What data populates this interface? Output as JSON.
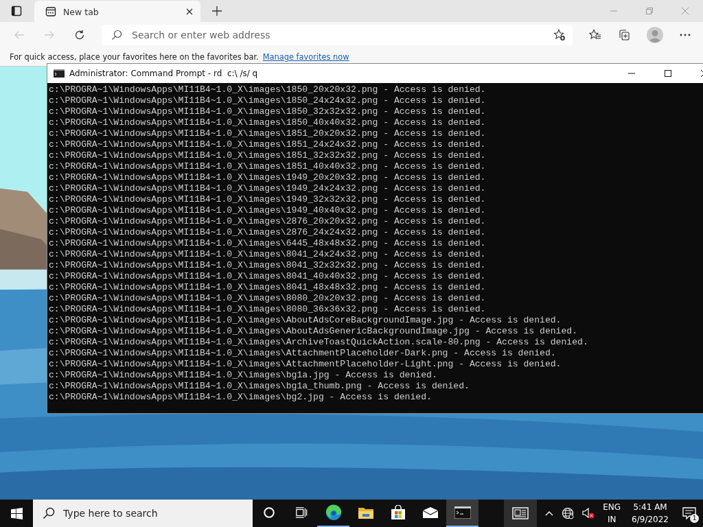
{
  "browser": {
    "tab": {
      "title": "New tab",
      "selected": true
    },
    "address": {
      "placeholder": "Search or enter web address"
    },
    "favorites_bar": {
      "message": "For quick access, place your favorites here on the favorites bar.",
      "link": "Manage favorites now"
    }
  },
  "console": {
    "title": "Administrator: Command Prompt - rd  c:\\ /s/ q",
    "lines": [
      "c:\\PROGRA~1\\WindowsApps\\MI11B4~1.0_X\\images\\1850_20x20x32.png - Access is denied.",
      "c:\\PROGRA~1\\WindowsApps\\MI11B4~1.0_X\\images\\1850_24x24x32.png - Access is denied.",
      "c:\\PROGRA~1\\WindowsApps\\MI11B4~1.0_X\\images\\1850_32x32x32.png - Access is denied.",
      "c:\\PROGRA~1\\WindowsApps\\MI11B4~1.0_X\\images\\1850_40x40x32.png - Access is denied.",
      "c:\\PROGRA~1\\WindowsApps\\MI11B4~1.0_X\\images\\1851_20x20x32.png - Access is denied.",
      "c:\\PROGRA~1\\WindowsApps\\MI11B4~1.0_X\\images\\1851_24x24x32.png - Access is denied.",
      "c:\\PROGRA~1\\WindowsApps\\MI11B4~1.0_X\\images\\1851_32x32x32.png - Access is denied.",
      "c:\\PROGRA~1\\WindowsApps\\MI11B4~1.0_X\\images\\1851_40x40x32.png - Access is denied.",
      "c:\\PROGRA~1\\WindowsApps\\MI11B4~1.0_X\\images\\1949_20x20x32.png - Access is denied.",
      "c:\\PROGRA~1\\WindowsApps\\MI11B4~1.0_X\\images\\1949_24x24x32.png - Access is denied.",
      "c:\\PROGRA~1\\WindowsApps\\MI11B4~1.0_X\\images\\1949_32x32x32.png - Access is denied.",
      "c:\\PROGRA~1\\WindowsApps\\MI11B4~1.0_X\\images\\1949_40x40x32.png - Access is denied.",
      "c:\\PROGRA~1\\WindowsApps\\MI11B4~1.0_X\\images\\2876_20x20x32.png - Access is denied.",
      "c:\\PROGRA~1\\WindowsApps\\MI11B4~1.0_X\\images\\2876_24x24x32.png - Access is denied.",
      "c:\\PROGRA~1\\WindowsApps\\MI11B4~1.0_X\\images\\6445_48x48x32.png - Access is denied.",
      "c:\\PROGRA~1\\WindowsApps\\MI11B4~1.0_X\\images\\8041_24x24x32.png - Access is denied.",
      "c:\\PROGRA~1\\WindowsApps\\MI11B4~1.0_X\\images\\8041_32x32x32.png - Access is denied.",
      "c:\\PROGRA~1\\WindowsApps\\MI11B4~1.0_X\\images\\8041_40x40x32.png - Access is denied.",
      "c:\\PROGRA~1\\WindowsApps\\MI11B4~1.0_X\\images\\8041_48x48x32.png - Access is denied.",
      "c:\\PROGRA~1\\WindowsApps\\MI11B4~1.0_X\\images\\8080_20x20x32.png - Access is denied.",
      "c:\\PROGRA~1\\WindowsApps\\MI11B4~1.0_X\\images\\8080_36x36x32.png - Access is denied.",
      "c:\\PROGRA~1\\WindowsApps\\MI11B4~1.0_X\\images\\AboutAdsCoreBackgroundImage.jpg - Access is denied.",
      "c:\\PROGRA~1\\WindowsApps\\MI11B4~1.0_X\\images\\AboutAdsGenericBackgroundImage.jpg - Access is denied.",
      "c:\\PROGRA~1\\WindowsApps\\MI11B4~1.0_X\\images\\ArchiveToastQuickAction.scale-80.png - Access is denied.",
      "c:\\PROGRA~1\\WindowsApps\\MI11B4~1.0_X\\images\\AttachmentPlaceholder-Dark.png - Access is denied.",
      "c:\\PROGRA~1\\WindowsApps\\MI11B4~1.0_X\\images\\AttachmentPlaceholder-Light.png - Access is denied.",
      "c:\\PROGRA~1\\WindowsApps\\MI11B4~1.0_X\\images\\bg1a.jpg - Access is denied.",
      "c:\\PROGRA~1\\WindowsApps\\MI11B4~1.0_X\\images\\bg1a_thumb.png - Access is denied.",
      "c:\\PROGRA~1\\WindowsApps\\MI11B4~1.0_X\\images\\bg2.jpg - Access is denied."
    ]
  },
  "taskbar": {
    "search": {
      "placeholder": "Type here to search"
    },
    "apps": [
      {
        "kind": "cortana",
        "running": false,
        "selected": false
      },
      {
        "kind": "taskview",
        "running": false,
        "selected": false
      },
      {
        "kind": "edge",
        "running": true,
        "selected": false
      },
      {
        "kind": "explorer",
        "running": false,
        "selected": false
      },
      {
        "kind": "store",
        "running": false,
        "selected": false
      },
      {
        "kind": "mail",
        "running": false,
        "selected": false
      },
      {
        "kind": "console",
        "running": true,
        "selected": true
      }
    ],
    "language": "ENG",
    "region": "IN",
    "time": "5:41 AM",
    "date": "6/9/2022",
    "notifications": "1"
  }
}
